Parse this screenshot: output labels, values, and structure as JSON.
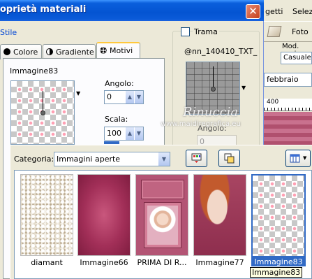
{
  "background_app": {
    "menu_items": [
      "getti",
      "Selezi"
    ],
    "toolbar_label": "Foto",
    "mod_label": "Mod. posiz",
    "mod_value": "Casuale",
    "field_value": "febbraio",
    "ruler_value": "400"
  },
  "dialog": {
    "title": "oprietà materiali",
    "close_glyph": "✕",
    "style_group_label": "Stile",
    "tabs": [
      {
        "label": "Colore",
        "icon": "circle-icon"
      },
      {
        "label": "Gradiente",
        "icon": "gradient-icon"
      },
      {
        "label": "Motivi",
        "icon": "pattern-icon",
        "active": true
      }
    ],
    "pattern_name": "Immagine83",
    "angle_label": "Angolo:",
    "angle_value": "0",
    "scale_label": "Scala:",
    "scale_value": "100",
    "texture_label": "Trama",
    "texture_checked": false,
    "texture_name": "@nn_140410_TXT_",
    "texture_angle_label": "Angolo:",
    "texture_angle_value": "0",
    "watermark_name": "Rinuccia",
    "watermark_url": "www.maidiregrafica.eu"
  },
  "browser": {
    "category_label": "Categoria:",
    "category_value": "Immagini aperte",
    "items": [
      {
        "label": "diamant",
        "selected": false
      },
      {
        "label": "Immagine66",
        "selected": false
      },
      {
        "label": "PRIMA DI R...",
        "selected": false
      },
      {
        "label": "Immagine77",
        "selected": false
      },
      {
        "label": "Immagine83",
        "selected": true
      }
    ],
    "tooltip": "Immagine83"
  },
  "colors": {
    "titlebar": "#0454d2",
    "group_label": "#0046d5",
    "selection": "#316ac5"
  }
}
